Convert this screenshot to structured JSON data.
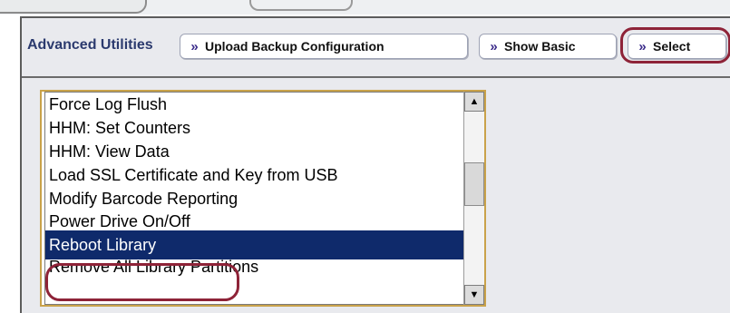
{
  "toolbar": {
    "title": "Advanced Utilities",
    "buttons": [
      {
        "label": "Upload Backup Configuration",
        "icon": "double-chevron-right-icon"
      },
      {
        "label": "Show Basic",
        "icon": "double-chevron-right-icon"
      },
      {
        "label": "Select",
        "icon": "double-chevron-right-icon"
      }
    ]
  },
  "list": {
    "items": [
      "Force Log Flush",
      "HHM: Set Counters",
      "HHM: View Data",
      "Load SSL Certificate and Key from USB",
      "Modify Barcode Reporting",
      "Power Drive On/Off",
      "Reboot Library",
      "Remove All Library Partitions"
    ],
    "selected": "Reboot Library"
  },
  "colors": {
    "selection_bg": "#0f2a6b",
    "callout": "#8e2338",
    "title": "#2b3a6e"
  },
  "icons": {
    "chevron": "»",
    "scroll_up": "▲",
    "scroll_down": "▼"
  }
}
